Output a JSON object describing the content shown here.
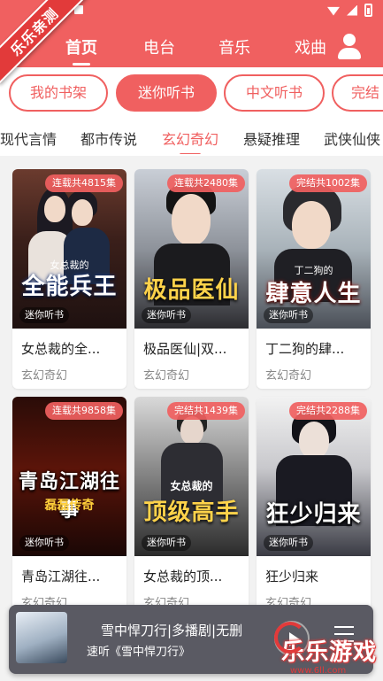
{
  "colors": {
    "accent": "#f06060",
    "background": "#f2f2f2",
    "player_bg": "#5a5a63"
  },
  "ribbon": {
    "text": "乐乐亲测"
  },
  "nav": {
    "tabs": [
      {
        "label": "首页",
        "active": true
      },
      {
        "label": "电台",
        "active": false
      },
      {
        "label": "音乐",
        "active": false
      },
      {
        "label": "戏曲",
        "active": false
      }
    ],
    "user_icon": "user-icon"
  },
  "pills": [
    {
      "label": "我的书架",
      "active": false
    },
    {
      "label": "迷你听书",
      "active": true
    },
    {
      "label": "中文听书",
      "active": false
    },
    {
      "label": "完结",
      "active": false
    }
  ],
  "categories": [
    {
      "label": "现代言情",
      "active": false
    },
    {
      "label": "都市传说",
      "active": false
    },
    {
      "label": "玄幻奇幻",
      "active": true
    },
    {
      "label": "悬疑推理",
      "active": false
    },
    {
      "label": "武侠仙侠",
      "active": false
    }
  ],
  "books": [
    {
      "badge": "连载共4815集",
      "source": "迷你听书",
      "title": "女总裁的全...",
      "category": "玄幻奇幻",
      "cover_title": "全能兵王",
      "cover_sub": "女总裁的"
    },
    {
      "badge": "连载共2480集",
      "source": "迷你听书",
      "title": "极品医仙|双...",
      "category": "玄幻奇幻",
      "cover_title": "极品医仙",
      "cover_sub": ""
    },
    {
      "badge": "完结共1002集",
      "source": "迷你听书",
      "title": "丁二狗的肆...",
      "category": "玄幻奇幻",
      "cover_title": "肆意人生",
      "cover_sub": "丁二狗的"
    },
    {
      "badge": "连载共9858集",
      "source": "迷你听书",
      "title": "青岛江湖往...",
      "category": "玄幻奇幻",
      "cover_title": "青岛江湖往事",
      "cover_sub": "磊磊传奇"
    },
    {
      "badge": "完结共1439集",
      "source": "迷你听书",
      "title": "女总裁的顶...",
      "category": "玄幻奇幻",
      "cover_title": "顶级高手",
      "cover_sub": "女总裁的"
    },
    {
      "badge": "完结共2288集",
      "source": "迷你听书",
      "title": "狂少归来",
      "category": "玄幻奇幻",
      "cover_title": "狂少归来",
      "cover_sub": ""
    }
  ],
  "player": {
    "title": "雪中悍刀行|多播剧|无删",
    "subtitle": "速听《雪中悍刀行》",
    "play_icon": "play-icon",
    "list_icon": "playlist-icon"
  },
  "watermark": {
    "text": "乐乐游戏",
    "url": "www.6ll.com"
  }
}
